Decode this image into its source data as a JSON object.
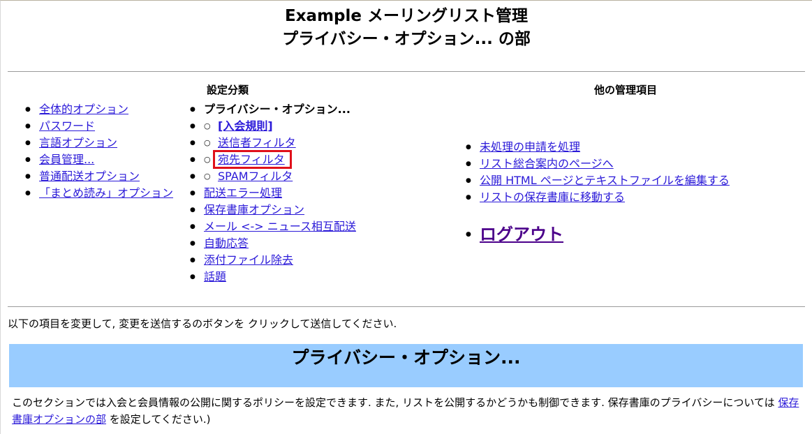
{
  "header": {
    "title_line1": "Example メーリングリスト管理",
    "title_line2": "プライバシー・オプション... の部"
  },
  "categories": {
    "heading": "設定分類",
    "col1": [
      "全体的オプション",
      "パスワード",
      "言語オプション",
      "会員管理...",
      "普通配送オプション",
      "「まとめ読み」オプション"
    ],
    "col2_current": "プライバシー・オプション...",
    "col2_sub": [
      "[入会規則]",
      "送信者フィルタ",
      "宛先フィルタ",
      "SPAMフィルタ"
    ],
    "col2": [
      "配送エラー処理",
      "保存書庫オプション",
      "メール <-> ニュース相互配送",
      "自動応答",
      "添付ファイル除去",
      "話題"
    ]
  },
  "other_admin": {
    "heading": "他の管理項目",
    "links": [
      "未処理の申請を処理",
      "リスト総合案内のページへ",
      "公開 HTML ページとテキストファイルを編集する",
      "リストの保存書庫に移動する"
    ],
    "logout": "ログアウト"
  },
  "instruction": "以下の項目を変更して, 変更を送信するのボタンを クリックして送信してください.",
  "section": {
    "title": "プライバシー・オプション...",
    "desc_before": "このセクションでは入会と会員情報の公開に関するポリシーを設定できます. また, リストを公開するかどうかも制御できます. 保存書庫のプライバシーについては ",
    "desc_link": "保存書庫オプションの部",
    "desc_after": " を設定してください.)"
  },
  "colors": {
    "link": "#2a19d8",
    "section_bg": "#99ccff",
    "highlight": "#e0101a",
    "logout": "#4b008a"
  }
}
